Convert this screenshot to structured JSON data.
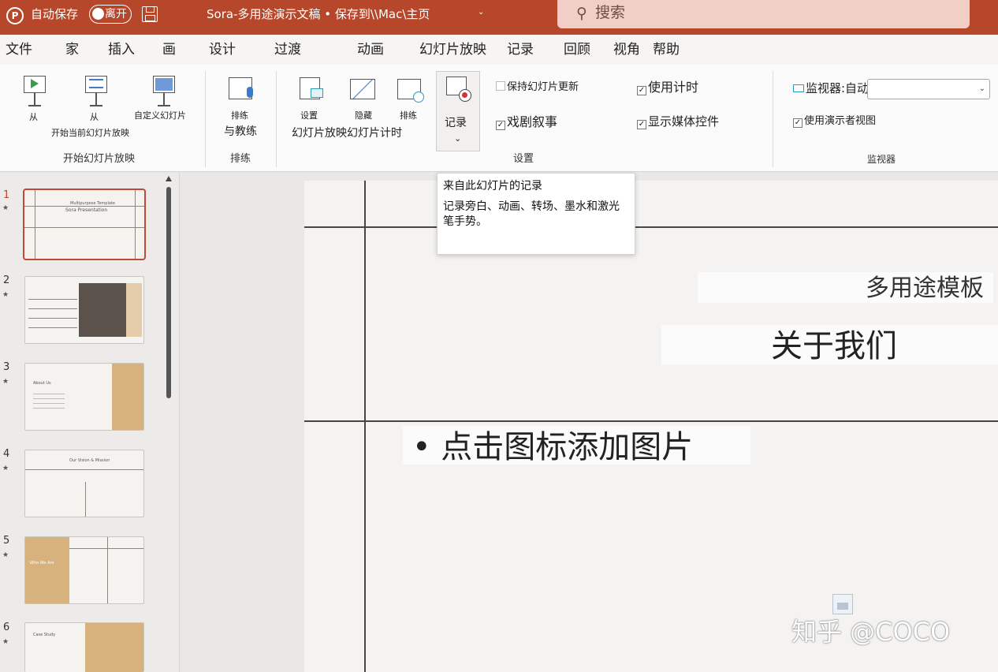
{
  "titlebar": {
    "autosave_label": "自动保存",
    "toggle_label": "离开",
    "doc_title": "Sora-多用途演示文稿 • 保存到\\\\Mac\\主页",
    "caret": "⌄",
    "search_placeholder": "搜索"
  },
  "tabs": [
    "文件",
    "家",
    "插入",
    "画",
    "设计",
    "过渡",
    "动画",
    "幻灯片放映",
    "记录",
    "回顾",
    "视角",
    "帮助"
  ],
  "ribbon": {
    "start_group": {
      "from_beginning_label": "从",
      "from_current_label": "从",
      "from_current_sub": "开始当前幻灯片放映",
      "custom_label": "自定义幻灯片",
      "group_label": "开始幻灯片放映"
    },
    "rehearse_group": {
      "rehearse_label": "排练",
      "coach_label": "与教练",
      "group_label": "排练"
    },
    "setup_group": {
      "setup_label": "设置",
      "hide_label": "隐藏",
      "timings_label": "排练",
      "combined_label": "幻灯片放映幻灯片计时",
      "record_label": "记录",
      "record_chevron": "⌄",
      "keep_updated": "保持幻灯片更新",
      "narration": "戏剧叙事",
      "use_timings": "使用计时",
      "show_media": "显示媒体控件",
      "group_label": "设置"
    },
    "monitors_group": {
      "monitor_label": "监视器:自动",
      "presenter_view": "使用演示者视图",
      "group_label": "监视器",
      "select_chevron": "⌄"
    }
  },
  "tooltip": {
    "title": "来自此幻灯片的记录",
    "body": "记录旁白、动画、转场、墨水和激光笔手势。"
  },
  "slides": [
    {
      "number": "1",
      "star": "★"
    },
    {
      "number": "2",
      "star": "★"
    },
    {
      "number": "3",
      "star": "★"
    },
    {
      "number": "4",
      "star": "★"
    },
    {
      "number": "5",
      "star": "★"
    },
    {
      "number": "6",
      "star": "★"
    }
  ],
  "thumb_texts": {
    "t1_line1": "Multipurpose Template",
    "t1_line2": "Sora Presentation",
    "t3_title": "About Us",
    "t4_title": "Our Vision & Mission",
    "t5_a": "Who We Are",
    "t6_title": "Case Study"
  },
  "slide": {
    "subtitle": "多用途模板",
    "title": "关于我们",
    "bullet": "• 点击图标添加图片"
  },
  "watermark": "知乎 @COCO",
  "colors": {
    "titlebar": "#b7472a",
    "accent_tan": "#d8b27c",
    "accent_brown": "#5b524b",
    "selection": "#c04a33"
  }
}
